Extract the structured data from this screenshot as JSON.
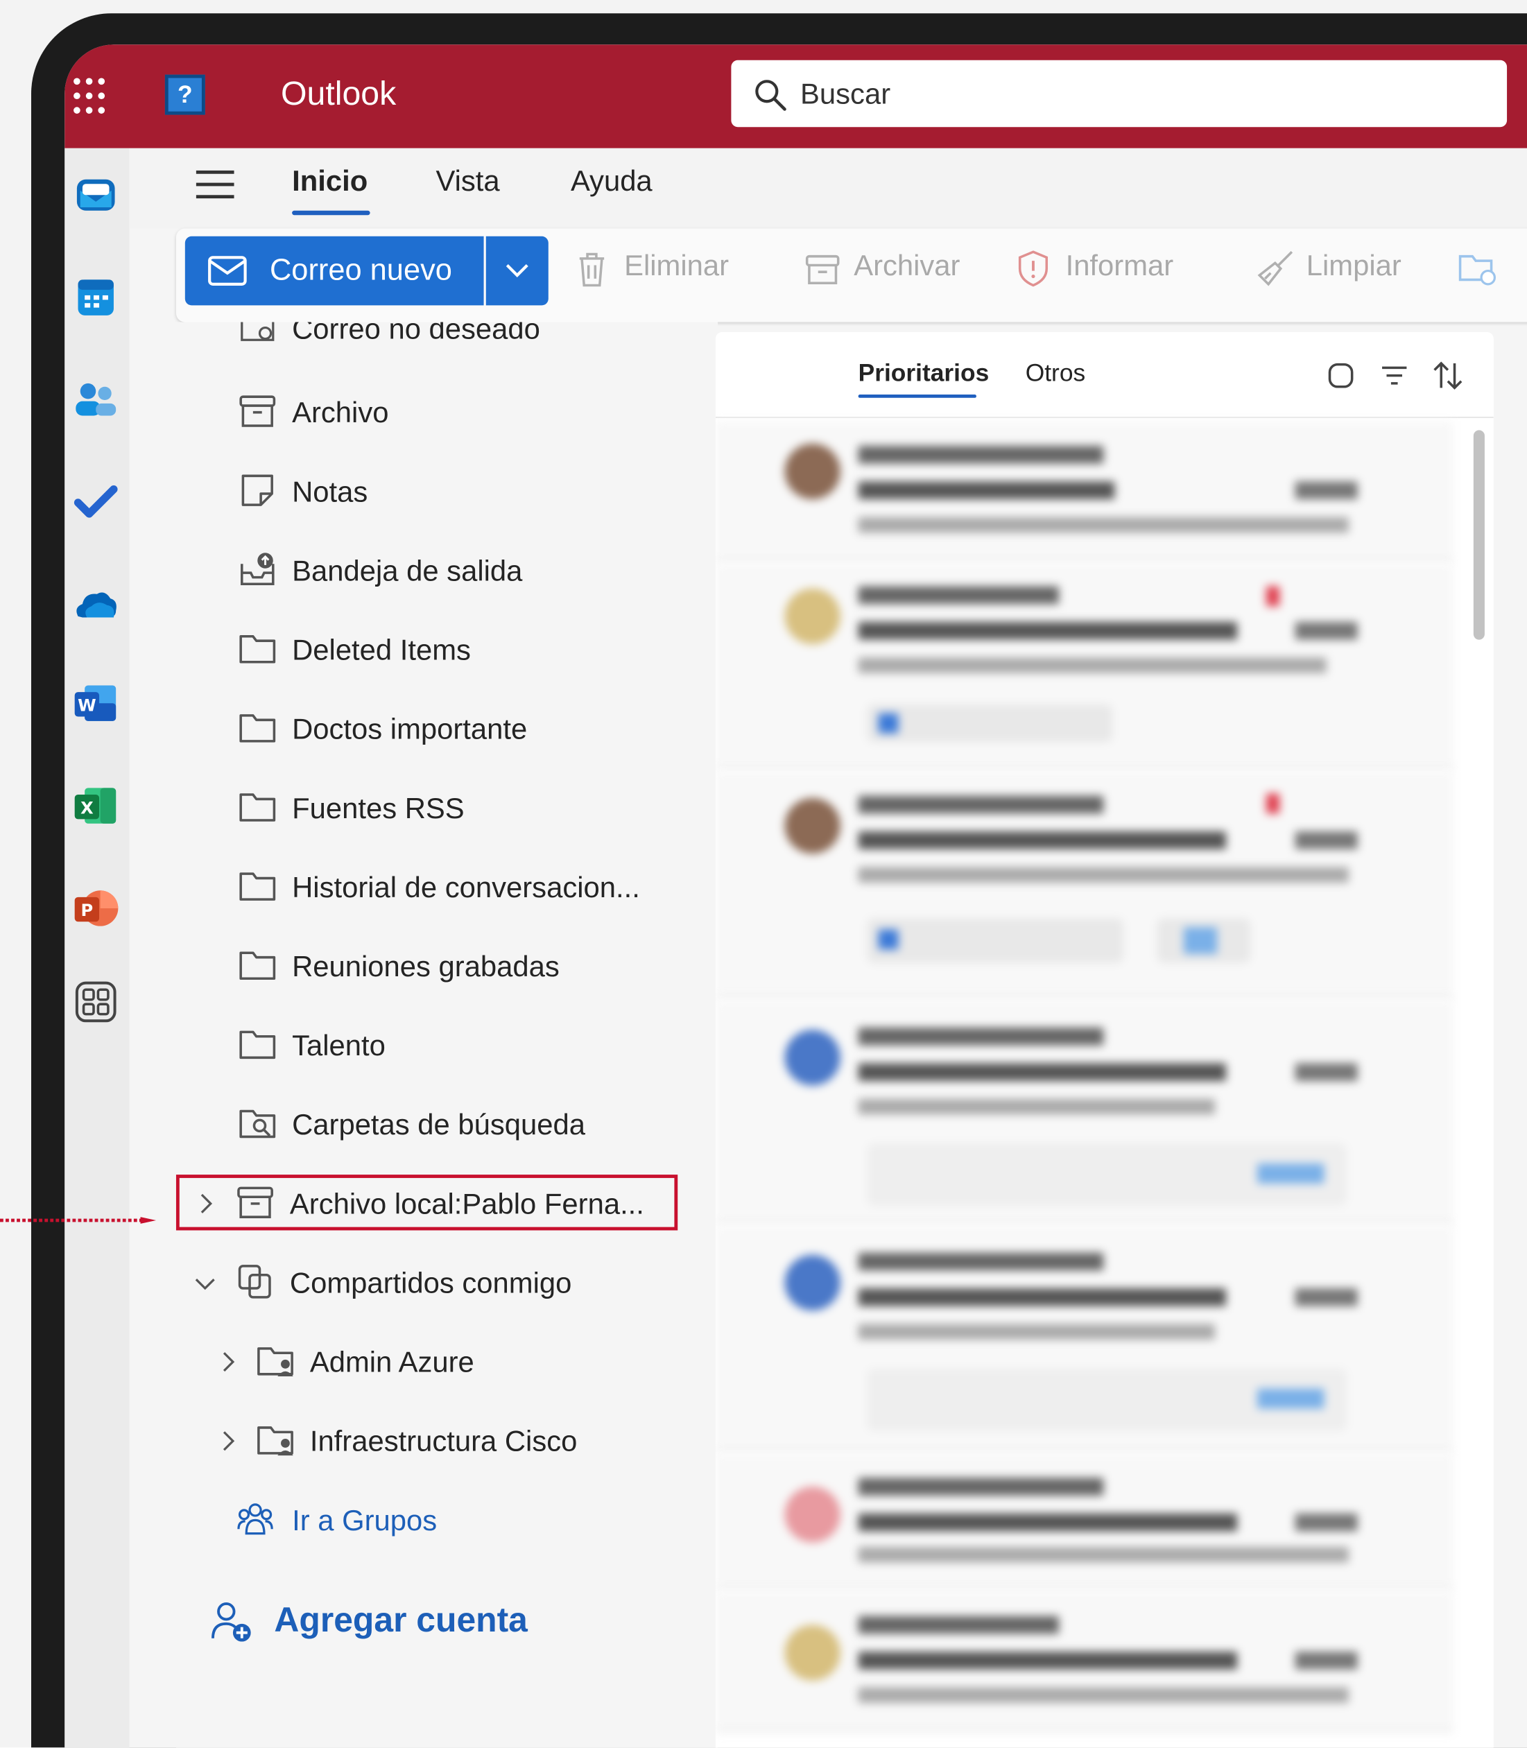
{
  "app": {
    "title": "Outlook",
    "search_placeholder": "Buscar"
  },
  "menu_tabs": [
    "Inicio",
    "Vista",
    "Ayuda"
  ],
  "ribbon": {
    "new_mail": "Correo nuevo",
    "actions": [
      "Eliminar",
      "Archivar",
      "Informar",
      "Limpiar"
    ]
  },
  "folders": {
    "partial_top": "Correo no deseado",
    "items": [
      {
        "label": "Archivo",
        "icon": "archive-icon"
      },
      {
        "label": "Notas",
        "icon": "notes-icon"
      },
      {
        "label": "Bandeja de salida",
        "icon": "outbox-icon"
      },
      {
        "label": "Deleted Items",
        "icon": "folder-icon"
      },
      {
        "label": "Doctos importante",
        "icon": "folder-icon"
      },
      {
        "label": "Fuentes RSS",
        "icon": "folder-icon"
      },
      {
        "label": "Historial de conversacion...",
        "icon": "folder-icon"
      },
      {
        "label": "Reuniones grabadas",
        "icon": "folder-icon"
      },
      {
        "label": "Talento",
        "icon": "folder-icon"
      },
      {
        "label": "Carpetas de búsqueda",
        "icon": "search-folder-icon"
      }
    ],
    "local_archive": "Archivo local:Pablo Ferna...",
    "shared": "Compartidos conmigo",
    "shared_items": [
      "Admin Azure",
      "Infraestructura Cisco"
    ],
    "groups_link": "Ir a Grupos",
    "add_account": "Agregar cuenta"
  },
  "mail_list": {
    "tabs": [
      "Prioritarios",
      "Otros"
    ],
    "items_count": 7
  },
  "colors": {
    "brand": "#a51c30",
    "primary": "#1f6fd1",
    "highlight": "#c8102e"
  }
}
